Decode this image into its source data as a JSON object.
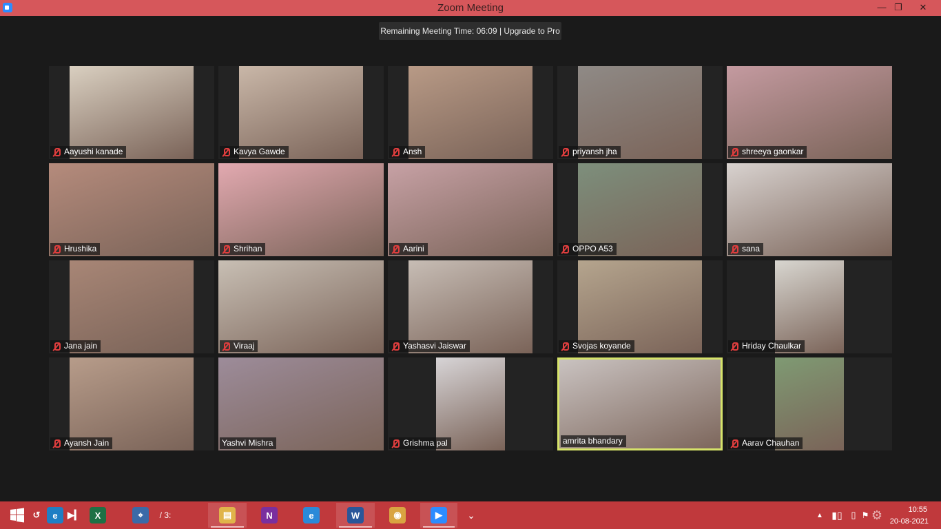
{
  "window": {
    "title": "Zoom Meeting",
    "min_glyph": "—",
    "max_glyph": "❐",
    "close_glyph": "✕"
  },
  "meeting": {
    "timer_text": "Remaining Meeting Time: 06:09 | Upgrade to Pro"
  },
  "participants": [
    {
      "name": "Aayushi kanade",
      "muted": true,
      "bg": "#d9cfc0"
    },
    {
      "name": "Kavya Gawde",
      "muted": true,
      "bg": "#c9b7a8"
    },
    {
      "name": "Ansh",
      "muted": true,
      "bg": "#b89a86"
    },
    {
      "name": "priyansh jha",
      "muted": true,
      "bg": "#8f8a86"
    },
    {
      "name": "shreeya gaonkar",
      "muted": true,
      "bg": "#c49aa0"
    },
    {
      "name": "Hrushika",
      "muted": true,
      "bg": "#b58b7c"
    },
    {
      "name": "Shrihan",
      "muted": true,
      "bg": "#e2a9b0"
    },
    {
      "name": "Aarini",
      "muted": true,
      "bg": "#c7a1a5"
    },
    {
      "name": "OPPO A53",
      "muted": true,
      "bg": "#7d8f7c"
    },
    {
      "name": "sana",
      "muted": true,
      "bg": "#d8d2cf"
    },
    {
      "name": "Jana jain",
      "muted": true,
      "bg": "#a88676"
    },
    {
      "name": "Viraaj",
      "muted": true,
      "bg": "#c8bfb4"
    },
    {
      "name": "Yashasvi Jaiswar",
      "muted": true,
      "bg": "#c7bdb5"
    },
    {
      "name": "Svojas koyande",
      "muted": true,
      "bg": "#b5a58e"
    },
    {
      "name": "Hriday Chaulkar",
      "muted": true,
      "bg": "#d8d6d0"
    },
    {
      "name": "Ayansh Jain",
      "muted": true,
      "bg": "#b79c8a"
    },
    {
      "name": "Yashvi Mishra",
      "muted": false,
      "bg": "#9d8c9a"
    },
    {
      "name": "Grishma pal",
      "muted": true,
      "bg": "#d7d4d6"
    },
    {
      "name": "amrita bhandary",
      "muted": false,
      "bg": "#c9c2c0",
      "active": true
    },
    {
      "name": "Aarav Chauhan",
      "muted": true,
      "bg": "#7f9a73"
    }
  ],
  "taskbar": {
    "start_icon": "windows-start",
    "items": [
      {
        "icon": "undo-icon",
        "glyph": "↺",
        "color": "#c0393c"
      },
      {
        "icon": "edge-icon",
        "glyph": "e",
        "color": "#1e7fc4"
      },
      {
        "icon": "media-next-icon",
        "glyph": "▶▎",
        "color": "#c0393c"
      },
      {
        "icon": "excel-icon",
        "glyph": "X",
        "color": "#1e7145"
      },
      {
        "icon": "lenovo-icon",
        "glyph": "⌖",
        "color": "#3a6aa8"
      },
      {
        "icon": "file-explorer-icon",
        "glyph": "▤",
        "color": "#e0b44a"
      },
      {
        "icon": "onenote-icon",
        "glyph": "N",
        "color": "#7a2f9e"
      },
      {
        "icon": "internet-explorer-icon",
        "glyph": "e",
        "color": "#2a8ad9"
      },
      {
        "icon": "word-icon",
        "glyph": "W",
        "color": "#2a5699"
      },
      {
        "icon": "chrome-icon",
        "glyph": "◉",
        "color": "#d9a441"
      },
      {
        "icon": "zoom-icon",
        "glyph": "▶",
        "color": "#2d8cff"
      }
    ],
    "overflow_text": "/ 3:",
    "clock_time": "10:55",
    "clock_date": "20-08-2021"
  }
}
